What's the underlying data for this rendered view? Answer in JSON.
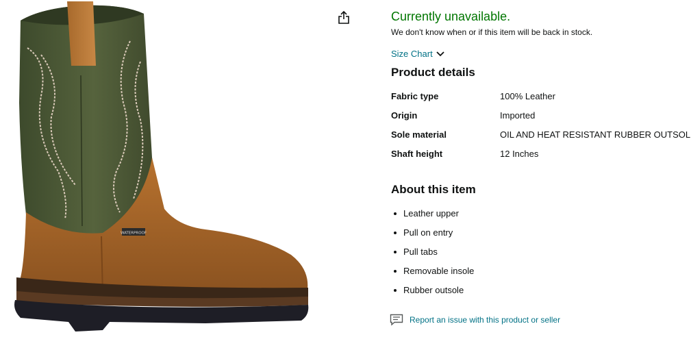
{
  "product": {
    "image_alt": "boot-image",
    "availability": "Currently unavailable.",
    "stock_note": "We don't know when or if this item will be back in stock.",
    "size_chart_label": "Size Chart",
    "boot_tag_text": "WATERPROOF"
  },
  "product_details": {
    "title": "Product details",
    "specs": [
      {
        "key": "Fabric type",
        "value": "100% Leather"
      },
      {
        "key": "Origin",
        "value": "Imported"
      },
      {
        "key": "Sole material",
        "value": "OIL AND HEAT RESISTANT RUBBER OUTSOLE"
      },
      {
        "key": "Shaft height",
        "value": "12 Inches"
      }
    ]
  },
  "about": {
    "title": "About this item",
    "bullets": [
      "Leather upper",
      "Pull on entry",
      "Pull tabs",
      "Removable insole",
      "Rubber outsole"
    ]
  },
  "report": {
    "label": "Report an issue with this product or seller",
    "icon": "feedback-icon"
  },
  "icons": {
    "share": "share-icon",
    "chevron": "chevron-down-icon"
  },
  "colors": {
    "available_green": "#007600",
    "link_teal": "#007185",
    "text": "#0f1111"
  }
}
